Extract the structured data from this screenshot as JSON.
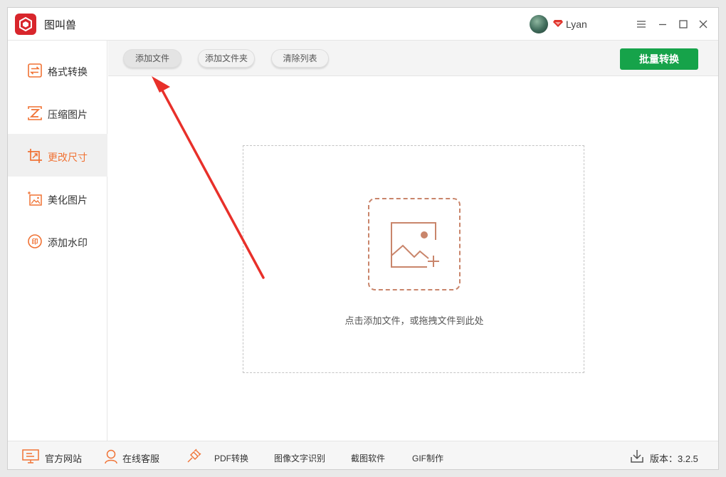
{
  "app": {
    "title": "图叫兽"
  },
  "user": {
    "name": "Lyan"
  },
  "sidebar": {
    "items": [
      {
        "label": "格式转换",
        "icon": "format-convert-icon"
      },
      {
        "label": "压缩图片",
        "icon": "compress-icon"
      },
      {
        "label": "更改尺寸",
        "icon": "resize-icon",
        "active": true
      },
      {
        "label": "美化图片",
        "icon": "beautify-icon"
      },
      {
        "label": "添加水印",
        "icon": "watermark-icon"
      }
    ]
  },
  "toolbar": {
    "add_file": "添加文件",
    "add_folder": "添加文件夹",
    "clear_list": "清除列表",
    "batch_convert": "批量转换"
  },
  "dropzone": {
    "hint": "点击添加文件，或拖拽文件到此处"
  },
  "footer": {
    "website": "官方网站",
    "support": "在线客服",
    "pdf": "PDF转换",
    "ocr": "图像文字识别",
    "screenshot": "截图软件",
    "gif": "GIF制作",
    "version": "版本：3.2.5"
  },
  "colors": {
    "accent": "#f07234",
    "primary_button": "#16a34a",
    "brand": "#d8262c",
    "annotation_arrow": "#e8302a"
  }
}
